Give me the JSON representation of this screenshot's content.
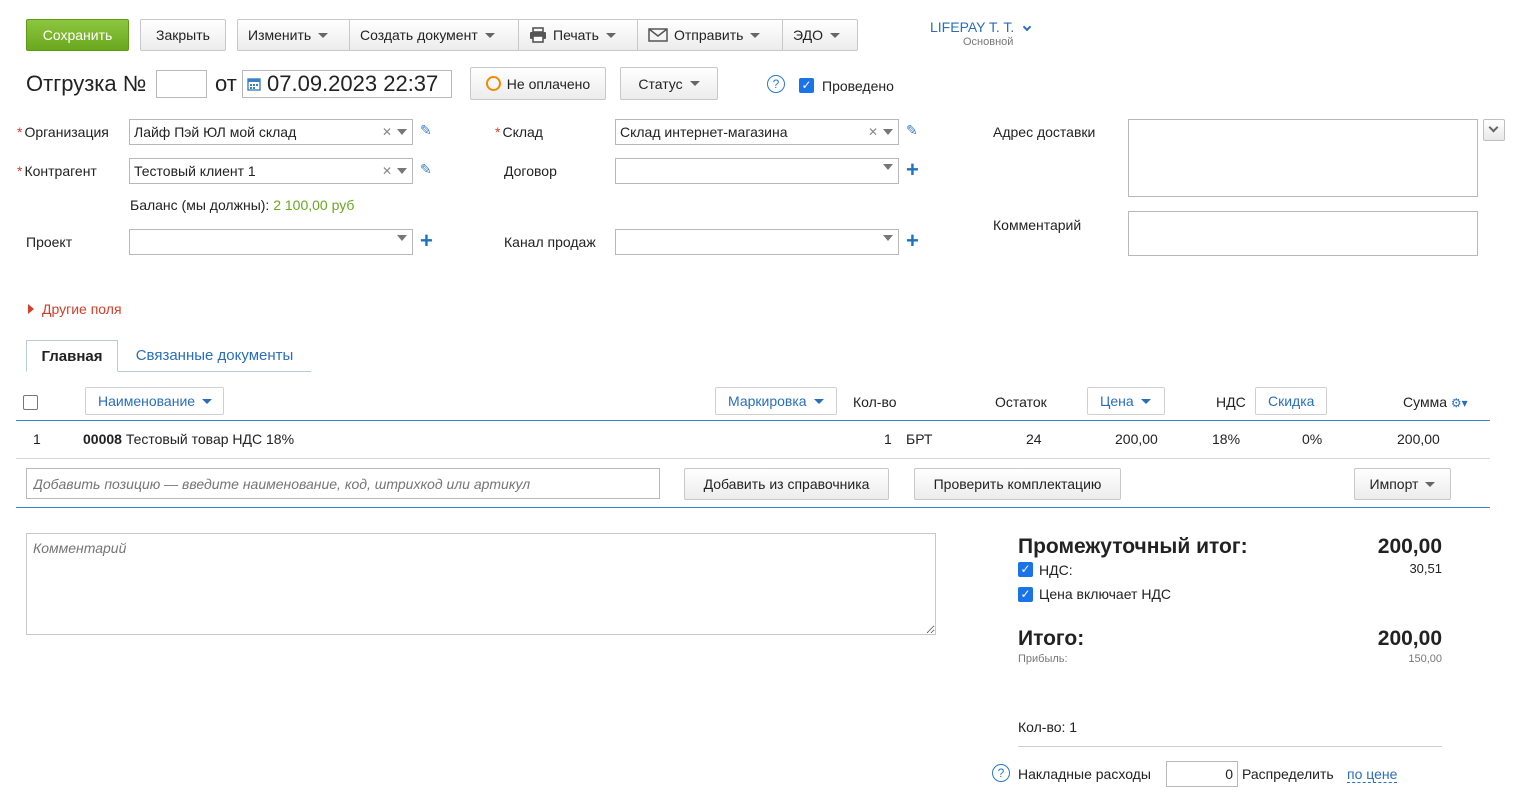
{
  "toolbar": {
    "save": "Сохранить",
    "close": "Закрыть",
    "edit": "Изменить",
    "create_doc": "Создать документ",
    "print": "Печать",
    "send": "Отправить",
    "edo": "ЭДО"
  },
  "user": {
    "name": "LIFEPAY T. T.",
    "role": "Основной"
  },
  "doc": {
    "title": "Отгрузка №",
    "number": "",
    "from": "от",
    "date": "07.09.2023 22:37",
    "payment_status": "Не оплачено",
    "status": "Статус",
    "posted_label": "Проведено"
  },
  "form": {
    "org_label": "Организация",
    "org_value": "Лайф Пэй ЮЛ мой склад",
    "contractor_label": "Контрагент",
    "contractor_value": "Тестовый клиент 1",
    "balance_label": "Баланс (мы должны):",
    "balance_value": "2 100,00 руб",
    "project_label": "Проект",
    "warehouse_label": "Склад",
    "warehouse_value": "Склад интернет-магазина",
    "contract_label": "Договор",
    "channel_label": "Канал продаж",
    "delivery_label": "Адрес доставки",
    "comment_label": "Комментарий",
    "other_fields": "Другие поля"
  },
  "tabs": {
    "main": "Главная",
    "related": "Связанные документы"
  },
  "table": {
    "headers": {
      "name": "Наименование",
      "marking": "Маркировка",
      "qty": "Кол-во",
      "stock": "Остаток",
      "price": "Цена",
      "vat": "НДС",
      "discount": "Скидка",
      "sum": "Сумма"
    },
    "rows": [
      {
        "num": "1",
        "code": "00008",
        "name": "Тестовый товар НДС 18%",
        "qty": "1",
        "unit": "БРТ",
        "stock": "24",
        "price": "200,00",
        "vat": "18%",
        "discount": "0%",
        "sum": "200,00"
      }
    ]
  },
  "add": {
    "placeholder": "Добавить позицию — введите наименование, код, штрихкод или артикул",
    "from_catalog": "Добавить из справочника",
    "check_kit": "Проверить комплектацию",
    "import": "Импорт"
  },
  "comment_placeholder": "Комментарий",
  "totals": {
    "subtotal_label": "Промежуточный итог:",
    "subtotal_value": "200,00",
    "vat_label": "НДС:",
    "vat_value": "30,51",
    "price_incl_vat": "Цена включает НДС",
    "total_label": "Итого:",
    "total_value": "200,00",
    "profit_label": "Прибыль:",
    "profit_value": "150,00",
    "qty_label": "Кол-во: 1",
    "overhead_label": "Накладные расходы",
    "overhead_value": "0",
    "distribute_label": "Распределить",
    "distribute_link": "по цене"
  }
}
